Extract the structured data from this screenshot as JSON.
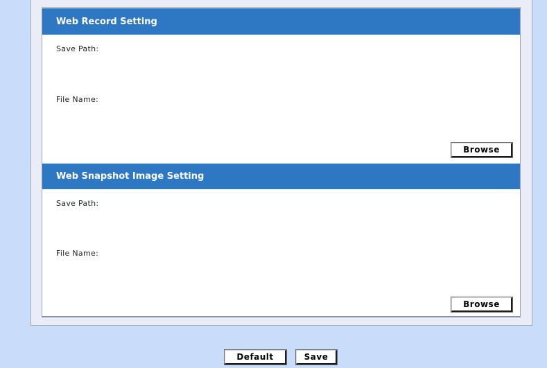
{
  "web_record": {
    "title": "Web Record Setting",
    "save_path_label": "Save Path:",
    "file_name_label": "File Name:",
    "browse_label": "Browse"
  },
  "web_snapshot": {
    "title": "Web Snapshot Image Setting",
    "save_path_label": "Save Path:",
    "file_name_label": "File Name:",
    "browse_label": "Browse"
  },
  "footer": {
    "default_label": "Default",
    "save_label": "Save"
  },
  "colors": {
    "page_background": "#c9dcfa",
    "section_header": "#2d77c3",
    "frame_background": "#eaecf8"
  }
}
